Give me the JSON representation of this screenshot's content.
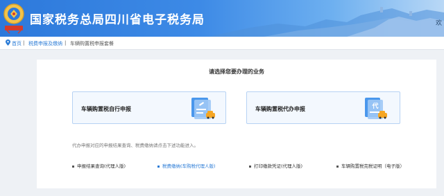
{
  "header": {
    "title": "国家税务总局四川省电子税务局",
    "right_text": "欢",
    "emblem_icon": "tax-emblem-icon"
  },
  "breadcrumb": {
    "home": "首页",
    "section": "税费申报及缴纳",
    "current": "车辆购置税申报套餐",
    "pin_icon": "location-pin-icon"
  },
  "main": {
    "prompt": "请选择您要办理的业务",
    "cards": [
      {
        "label": "车辆购置税自行申报",
        "icon": "document-car-icon"
      },
      {
        "label": "车辆购置税代办申报",
        "icon": "proxy-document-car-icon",
        "badge": "代"
      }
    ],
    "note": "代办申报对应的申报结果查询、税费缴纳请点击下述功能进入。",
    "links": [
      {
        "label": "申报结果查询(代理人版)",
        "active": false
      },
      {
        "label": "税费缴纳(车购税代理人版)",
        "active": true
      },
      {
        "label": "打印缴款凭证(代理人版)",
        "active": false
      },
      {
        "label": "车辆购置税完税证明（电子版）",
        "active": false
      }
    ]
  },
  "colors": {
    "accent": "#2a7bd6",
    "header_blue": "#2d79db",
    "card_bg": "#f3f8fe",
    "card_border": "#b6d2f4",
    "car_orange": "#f5a623"
  }
}
